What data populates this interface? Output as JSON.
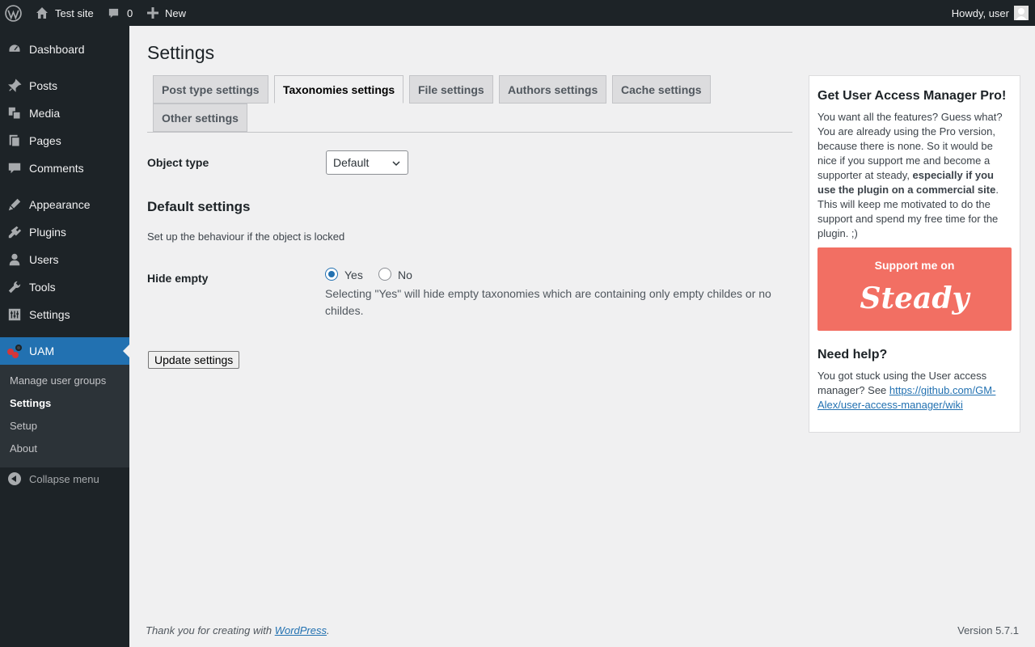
{
  "adminbar": {
    "site_name": "Test site",
    "comments_count": "0",
    "new_label": "New",
    "howdy": "Howdy, user"
  },
  "sidebar": {
    "items": [
      {
        "label": "Dashboard",
        "icon": "dashboard-icon"
      },
      {
        "label": "Posts",
        "icon": "pin-icon"
      },
      {
        "label": "Media",
        "icon": "media-icon"
      },
      {
        "label": "Pages",
        "icon": "pages-icon"
      },
      {
        "label": "Comments",
        "icon": "comment-icon"
      },
      {
        "label": "Appearance",
        "icon": "brush-icon"
      },
      {
        "label": "Plugins",
        "icon": "plugin-icon"
      },
      {
        "label": "Users",
        "icon": "user-icon"
      },
      {
        "label": "Tools",
        "icon": "wrench-icon"
      },
      {
        "label": "Settings",
        "icon": "settings-icon"
      },
      {
        "label": "UAM",
        "icon": "uam-icon"
      }
    ],
    "submenu": [
      "Manage user groups",
      "Settings",
      "Setup",
      "About"
    ],
    "collapse": "Collapse menu"
  },
  "main": {
    "title": "Settings",
    "tabs": [
      "Post type settings",
      "Taxonomies settings",
      "File settings",
      "Authors settings",
      "Cache settings",
      "Other settings"
    ],
    "object_type_label": "Object type",
    "object_type_value": "Default",
    "default_heading": "Default settings",
    "default_desc": "Set up the behaviour if the object is locked",
    "hide_empty_label": "Hide empty",
    "radio_yes": "Yes",
    "radio_no": "No",
    "hide_empty_desc": "Selecting \"Yes\" will hide empty taxonomies which are containing only empty childes or no childes.",
    "update_button": "Update settings"
  },
  "promo": {
    "title": "Get User Access Manager Pro!",
    "text_start": "You want all the features? Guess what? You are already using the Pro version, because there is none. So it would be nice if you support me and become a supporter at steady, ",
    "text_bold": "especially if you use the plugin on a commercial site",
    "text_end": ". This will keep me motivated to do the support and spend my free time for the plugin. ;)",
    "steady_small": "Support me on",
    "steady_big": "Steady",
    "help_title": "Need help?",
    "help_text": "You got stuck using the User access manager? See ",
    "help_link": "https://github.com/GM-Alex/user-access-manager/wiki"
  },
  "footer": {
    "thanks_start": "Thank you for creating with ",
    "thanks_link": "WordPress",
    "thanks_end": ".",
    "version": "Version 5.7.1"
  }
}
